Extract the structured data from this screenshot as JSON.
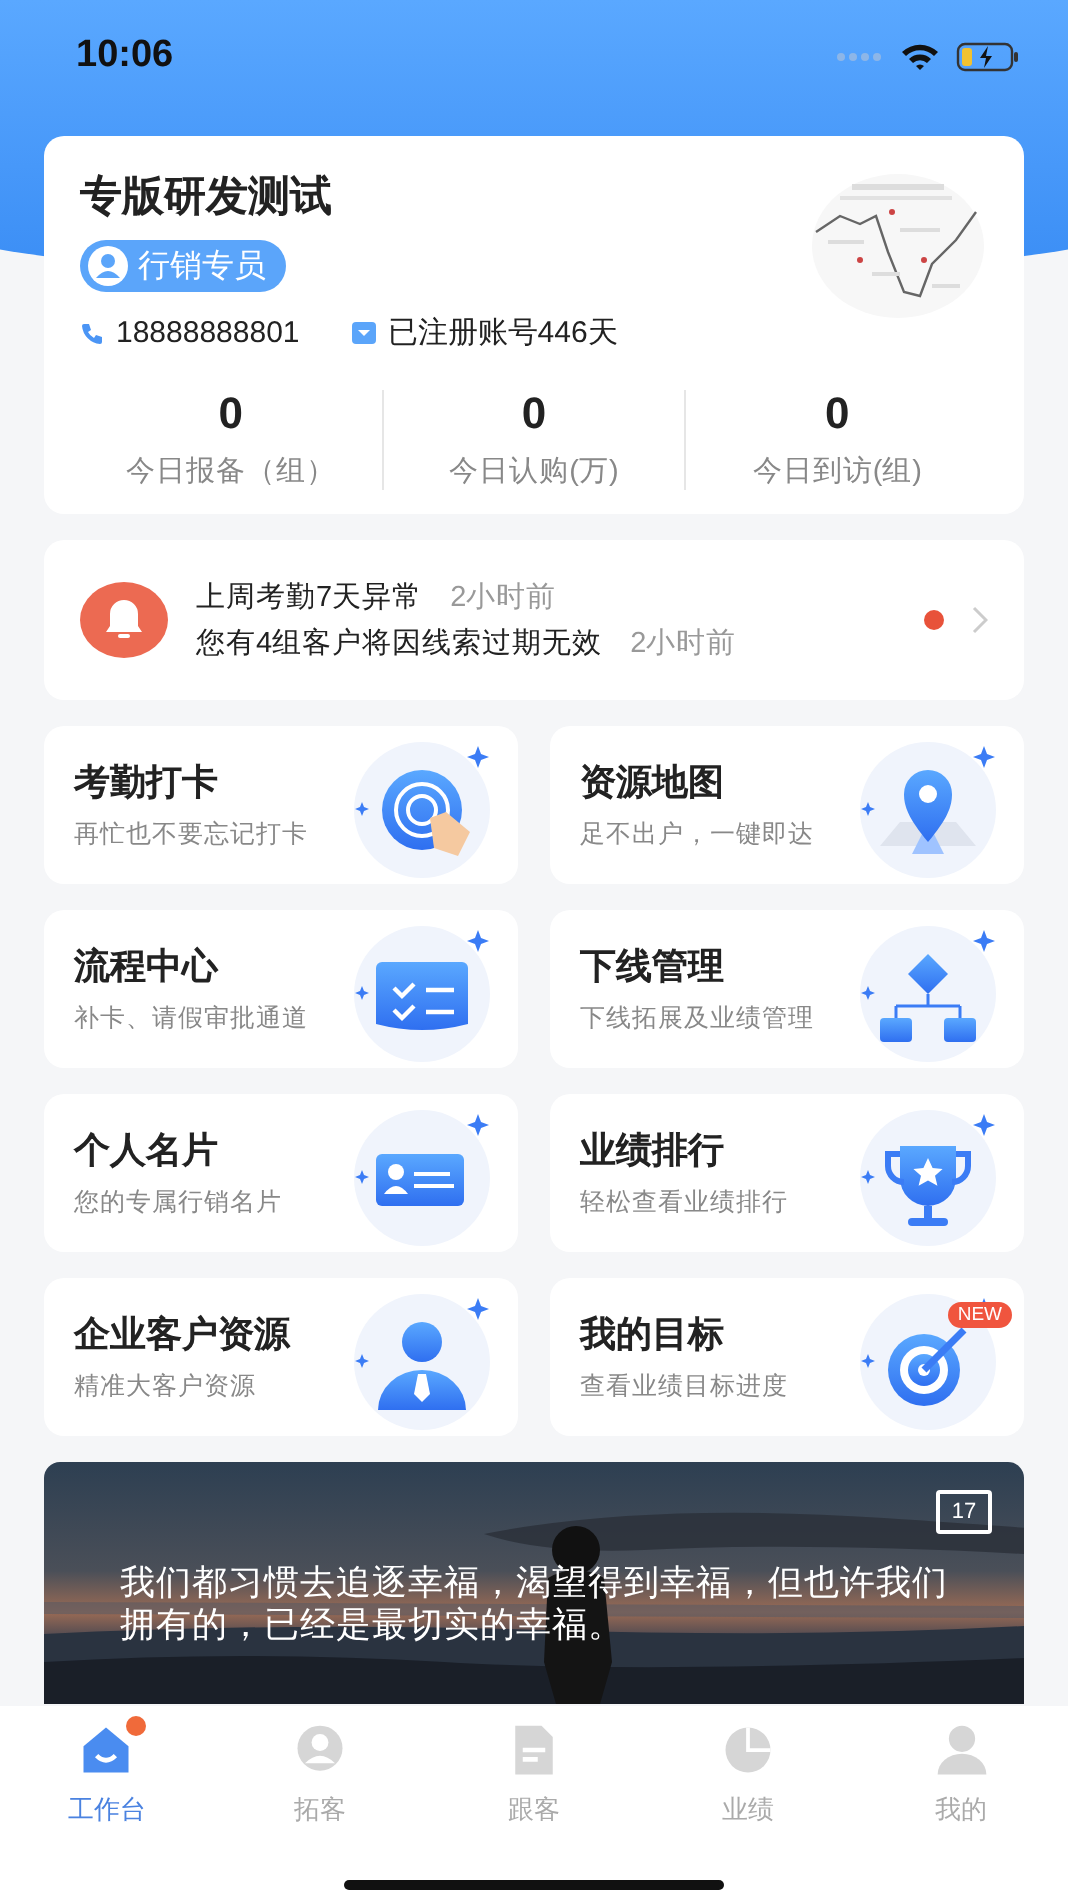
{
  "status_bar": {
    "time": "10:06"
  },
  "profile": {
    "name": "专版研发测试",
    "role": "行销专员",
    "phone": "18888888801",
    "registered": "已注册账号446天",
    "stats": [
      {
        "value": "0",
        "label": "今日报备（组）"
      },
      {
        "value": "0",
        "label": "今日认购(万)"
      },
      {
        "value": "0",
        "label": "今日到访(组)"
      }
    ]
  },
  "notices": {
    "unread": true,
    "items": [
      {
        "text": "上周考勤7天异常",
        "time": "2小时前"
      },
      {
        "text": "您有4组客户将因线索过期无效",
        "time": "2小时前"
      }
    ]
  },
  "shortcuts": [
    {
      "kind": "fingerprint",
      "title": "考勤打卡",
      "subtitle": "再忙也不要忘记打卡"
    },
    {
      "kind": "map",
      "title": "资源地图",
      "subtitle": "足不出户，一键即达"
    },
    {
      "kind": "checklist",
      "title": "流程中心",
      "subtitle": "补卡、请假审批通道"
    },
    {
      "kind": "org",
      "title": "下线管理",
      "subtitle": "下线拓展及业绩管理"
    },
    {
      "kind": "card",
      "title": "个人名片",
      "subtitle": "您的专属行销名片"
    },
    {
      "kind": "trophy",
      "title": "业绩排行",
      "subtitle": "轻松查看业绩排行"
    },
    {
      "kind": "person",
      "title": "企业客户资源",
      "subtitle": "精准大客户资源"
    },
    {
      "kind": "target",
      "title": "我的目标",
      "subtitle": "查看业绩目标进度",
      "badge": "NEW"
    }
  ],
  "banner": {
    "quote": "我们都习惯去追逐幸福，渴望得到幸福，但也许我们拥有的，已经是最切实的幸福。",
    "calendar_day": "17"
  },
  "tab_bar": [
    {
      "kind": "home",
      "label": "工作台",
      "selected": true,
      "dot": true
    },
    {
      "kind": "face",
      "label": "拓客",
      "selected": false,
      "dot": false
    },
    {
      "kind": "doc",
      "label": "跟客",
      "selected": false,
      "dot": false
    },
    {
      "kind": "pie",
      "label": "业绩",
      "selected": false,
      "dot": false
    },
    {
      "kind": "user",
      "label": "我的",
      "selected": false,
      "dot": false
    }
  ]
}
